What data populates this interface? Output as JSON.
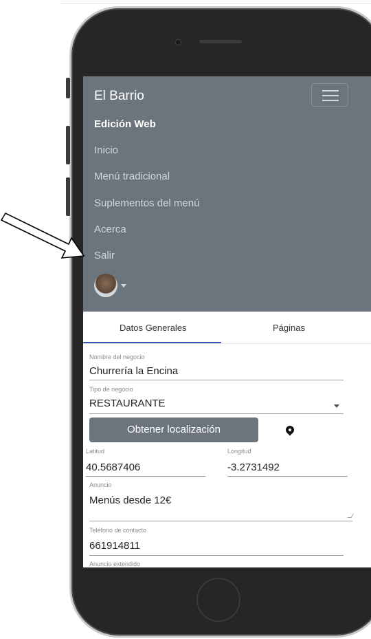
{
  "navbar": {
    "brand": "El Barrio",
    "items": [
      {
        "label": "Edición Web",
        "active": true
      },
      {
        "label": "Inicio"
      },
      {
        "label": "Menú tradicional"
      },
      {
        "label": "Suplementos del menú"
      },
      {
        "label": "Acerca"
      },
      {
        "label": "Salir"
      }
    ]
  },
  "tabs": [
    {
      "label": "Datos Generales",
      "selected": true
    },
    {
      "label": "Páginas"
    }
  ],
  "form": {
    "business_name": {
      "label": "Nombre del negocio",
      "value": "Churrería la Encina"
    },
    "business_type": {
      "label": "Tipo de negocio",
      "value": "RESTAURANTE"
    },
    "location_button": "Obtener localización",
    "latitude": {
      "label": "Latitud",
      "value": "40.5687406"
    },
    "longitude": {
      "label": "Longitud",
      "value": "-3.2731492"
    },
    "announcement": {
      "label": "Anuncio",
      "value": "Menús desde 12€"
    },
    "phone": {
      "label": "Teléfono de contacto",
      "value": "661914811"
    },
    "extended_announcement": {
      "label": "Anuncio extendido"
    }
  },
  "colors": {
    "navbar_bg": "#6c757d",
    "tab_indicator": "#3f51b5",
    "phone_body": "#262626"
  },
  "icons": {
    "menu": "hamburger-icon",
    "location": "map-pin-icon",
    "dropdown": "chevron-down-icon"
  }
}
